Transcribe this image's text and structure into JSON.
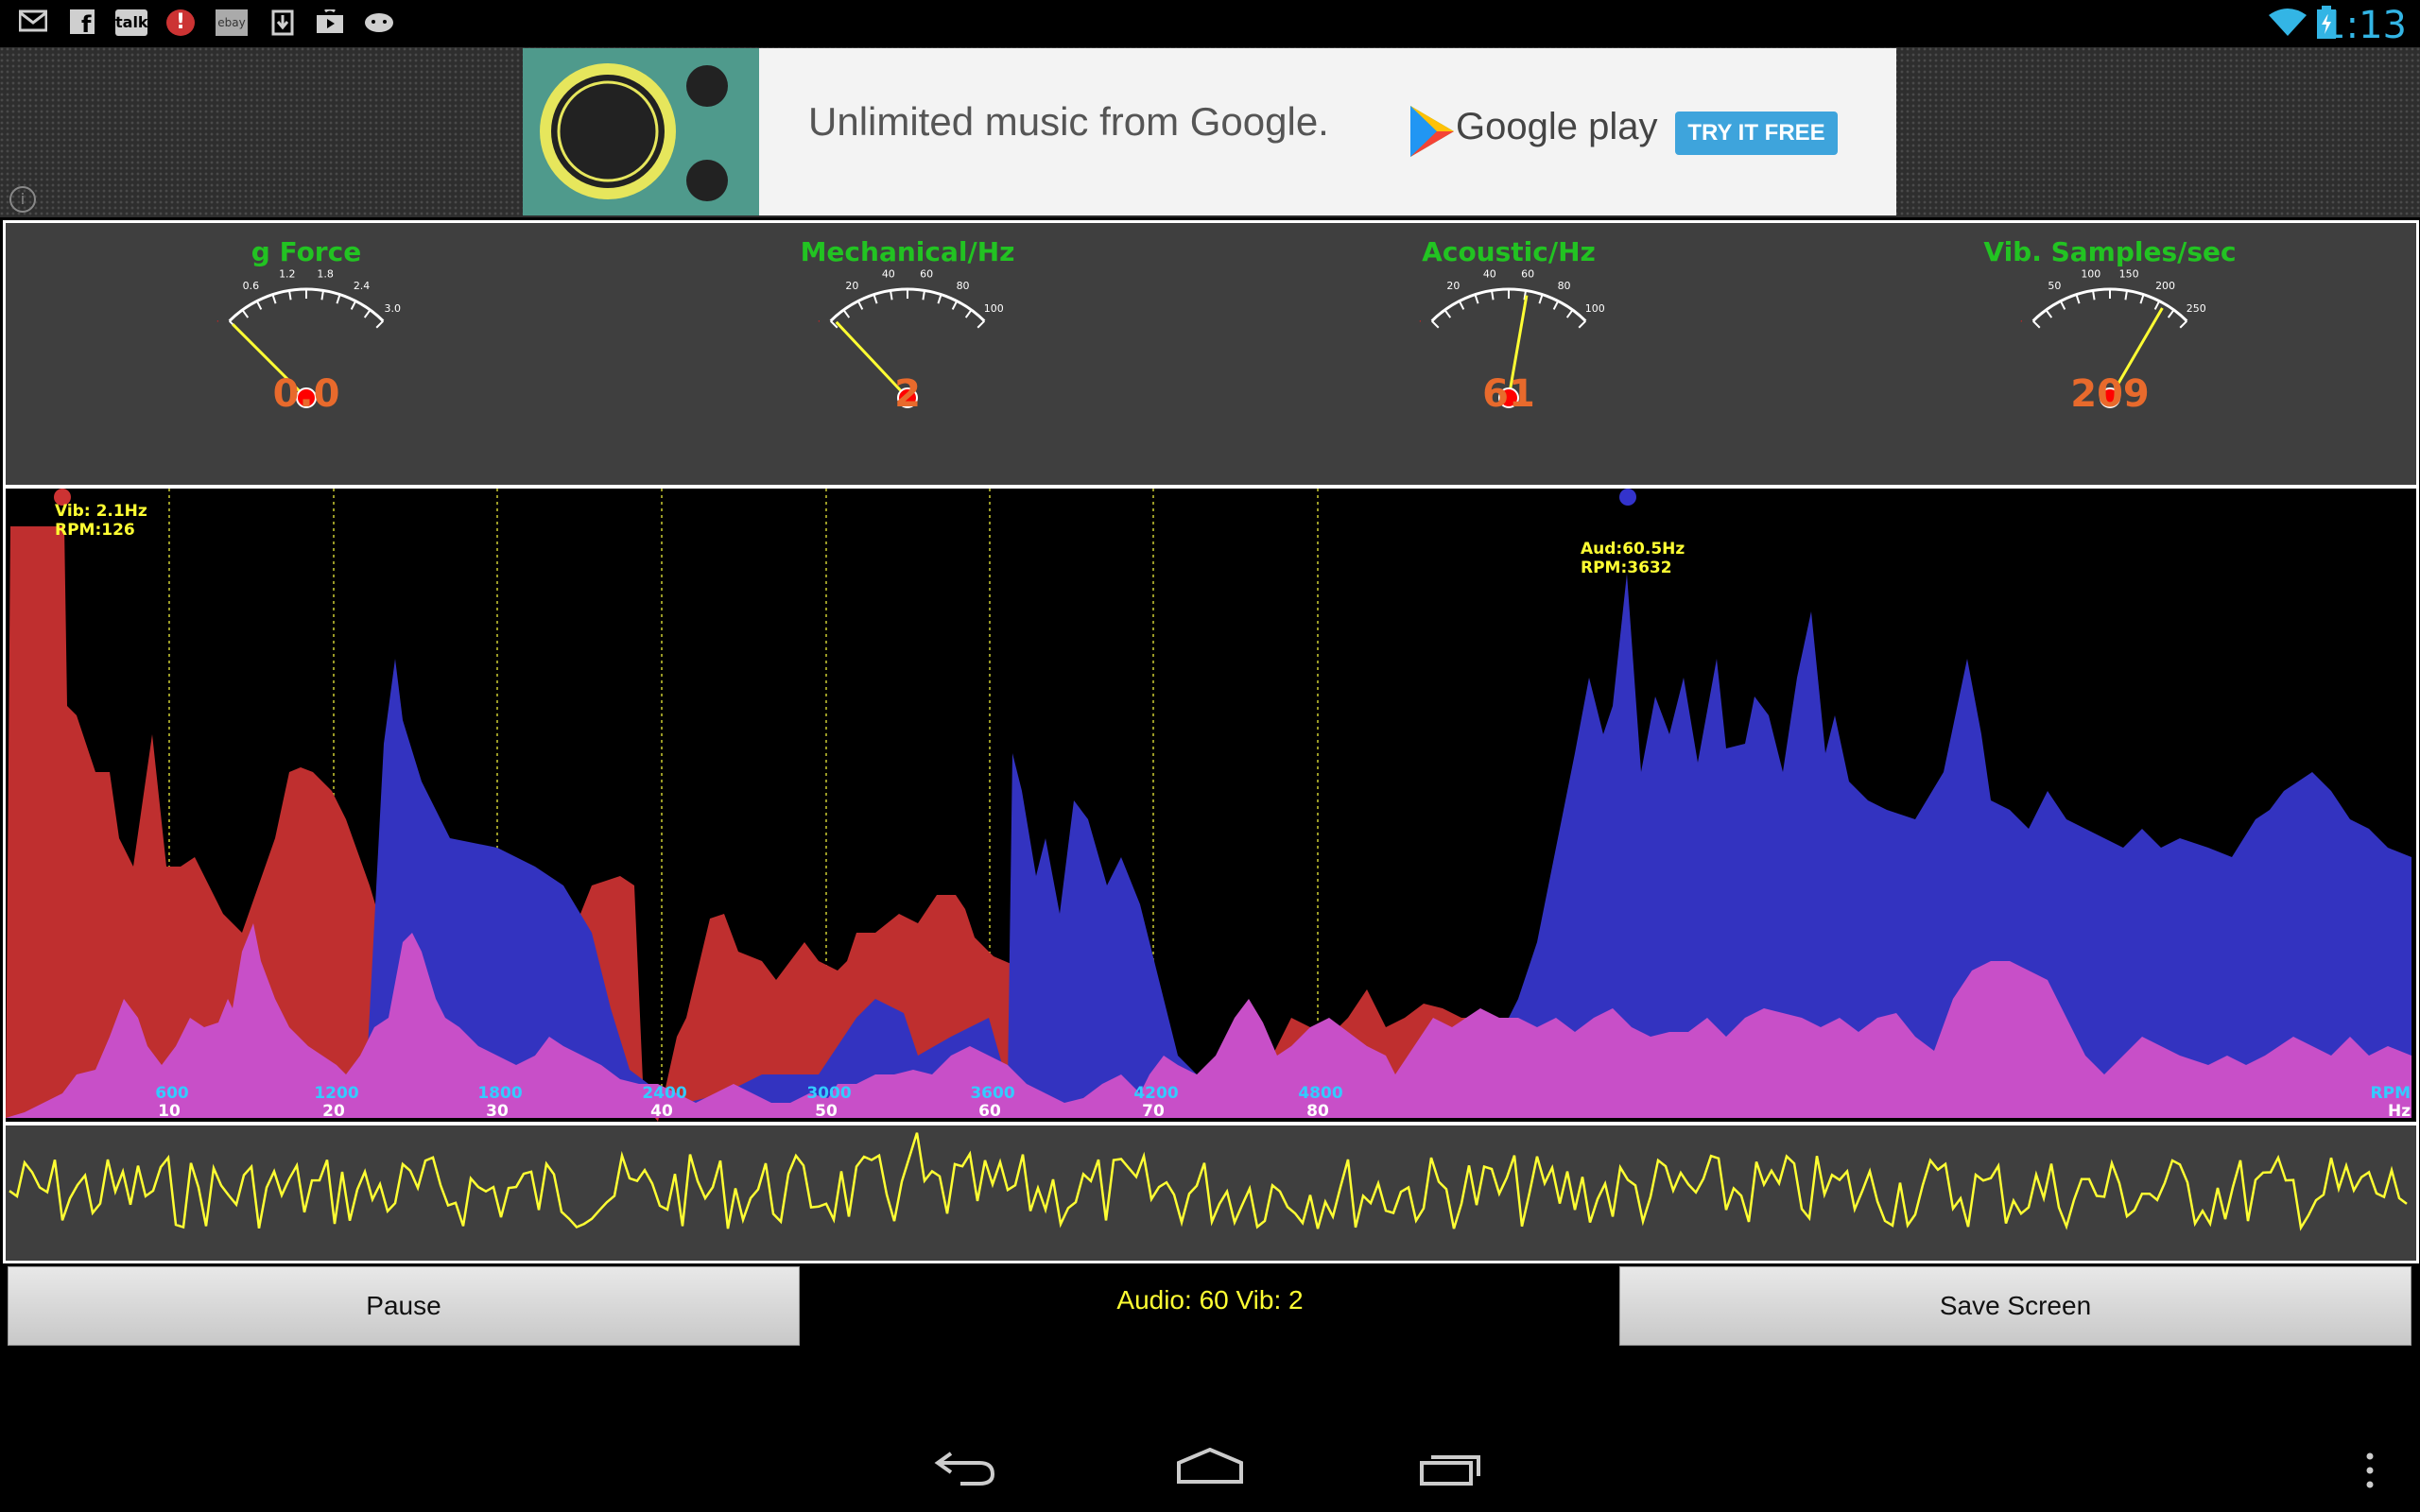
{
  "status_bar": {
    "notification_icons": [
      "gmail-icon",
      "facebook-icon",
      "talk-icon",
      "alert-icon",
      "ebay-icon",
      "download-icon",
      "play-store-icon",
      "android-icon"
    ],
    "talk_label": "talk",
    "ebay_label": "ebay",
    "time": "1:13"
  },
  "ad": {
    "headline": "Unlimited music from Google.",
    "brand": "Google play",
    "cta": "TRY IT FREE"
  },
  "gauges": [
    {
      "title": "g Force",
      "value": "0.0",
      "ticks": [
        "0.6",
        "1.2",
        "1.8",
        "2.4",
        "3.0"
      ],
      "needle_fraction": 0.0
    },
    {
      "title": "Mechanical/Hz",
      "value": "2",
      "ticks": [
        "20",
        "40",
        "60",
        "80",
        "100"
      ],
      "needle_fraction": 0.02
    },
    {
      "title": "Acoustic/Hz",
      "value": "61",
      "ticks": [
        "20",
        "40",
        "60",
        "80",
        "100"
      ],
      "needle_fraction": 0.61
    },
    {
      "title": "Vib. Samples/sec",
      "value": "209",
      "ticks": [
        "50",
        "100",
        "150",
        "200",
        "250"
      ],
      "needle_fraction": 0.836
    }
  ],
  "spectrum": {
    "vib_label": "Vib: 2.1Hz",
    "vib_rpm": "RPM:126",
    "aud_label": "Aud:60.5Hz",
    "aud_rpm": "RPM:3632",
    "rpm_ticks": [
      "600",
      "1200",
      "1800",
      "2400",
      "3000",
      "3600",
      "4200",
      "4800"
    ],
    "hz_ticks": [
      "10",
      "20",
      "30",
      "40",
      "50",
      "60",
      "70",
      "80"
    ],
    "rpm_unit": "RPM",
    "hz_unit": "Hz",
    "colors": {
      "vibration": "#bf2f2f",
      "audio": "#3333c0",
      "overlap": "#c84fc8",
      "grid": "#cccc33"
    }
  },
  "controls": {
    "pause_label": "Pause",
    "status": "Audio: 60 Vib: 2",
    "save_label": "Save Screen"
  },
  "nav": {
    "back": "back-icon",
    "home": "home-icon",
    "recents": "recents-icon",
    "menu": "overflow-menu-icon"
  }
}
